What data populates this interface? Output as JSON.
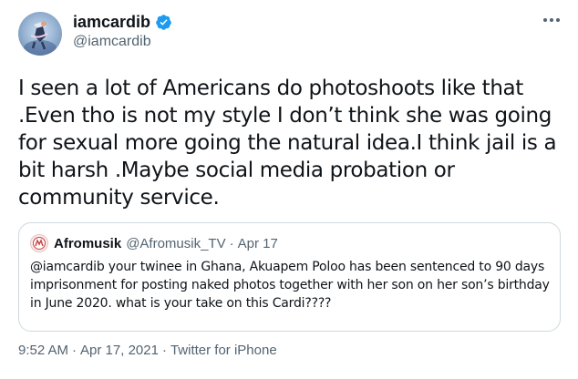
{
  "tweet": {
    "author": {
      "display_name": "iamcardib",
      "handle": "@iamcardib",
      "verified": true,
      "avatar_icon": "profile-photo"
    },
    "more_icon": "more-options-icon",
    "text": "I seen a lot of Americans do photoshoots like that .Even tho is not my style I don’t think she was going for sexual more going the natural idea.I think jail is a bit harsh .Maybe social media probation or community service.",
    "quoted": {
      "display_name": "Afromusik",
      "handle": "@Afromusik_TV",
      "separator": "·",
      "date": "Apr 17",
      "text": "@iamcardib your twinee in Ghana, Akuapem Poloo has been sentenced to 90 days imprisonment for posting naked photos together with her son on her son’s birthday in June 2020.  what is your take on this Cardi????"
    },
    "meta": {
      "time": "9:52 AM",
      "separator": "·",
      "date": "Apr 17, 2021",
      "source": "Twitter for iPhone"
    }
  },
  "colors": {
    "text": "#0f1419",
    "secondary": "#536471",
    "verified_blue": "#1d9bf0",
    "border": "#cfd9de"
  }
}
